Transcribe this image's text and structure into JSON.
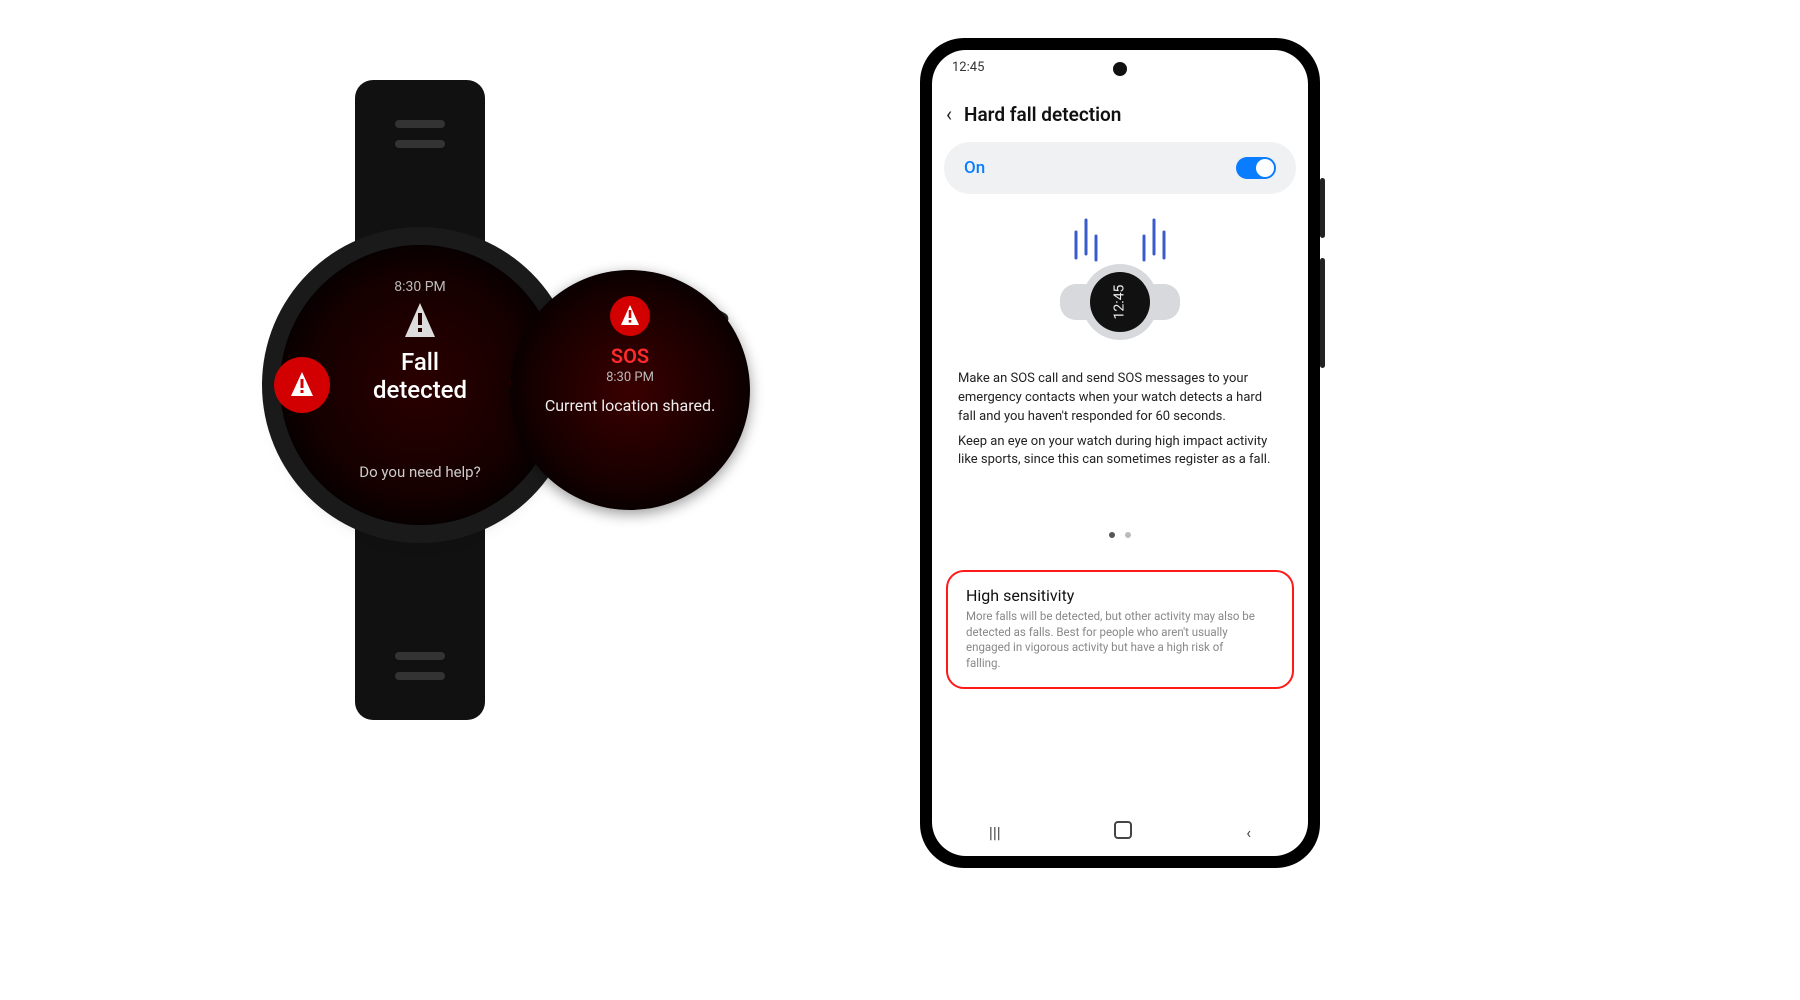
{
  "watch_main": {
    "time": "8:30 PM",
    "title_l1": "Fall",
    "title_l2": "detected",
    "subtitle": "Do you need help?",
    "left_btn_icon": "alert-icon",
    "right_btn_icon": "close-icon"
  },
  "watch_popout": {
    "sos_label": "SOS",
    "time": "8:30 PM",
    "message": "Current location shared."
  },
  "phone": {
    "status_time": "12:45",
    "header_title": "Hard fall detection",
    "on_row_label": "On",
    "on_row_state": "on",
    "illustration_watch_time": "12:45",
    "description_p1": "Make an SOS call and send SOS messages to your emergency contacts when your watch detects a hard fall and you haven't responded for 60 seconds.",
    "description_p2": "Keep an eye on your watch during high impact activity like sports, since this can sometimes register as a fall.",
    "pager": {
      "count": 2,
      "active": 0
    },
    "high_sensitivity": {
      "title": "High sensitivity",
      "desc": "More falls will be detected, but other activity may also be detected as falls. Best for people who aren't usually engaged in vigorous activity but have a high risk of falling.",
      "state": "on"
    }
  },
  "colors": {
    "accent_red": "#d20000",
    "accent_blue": "#0a7cff",
    "highlight_border": "#ff1a1a"
  }
}
